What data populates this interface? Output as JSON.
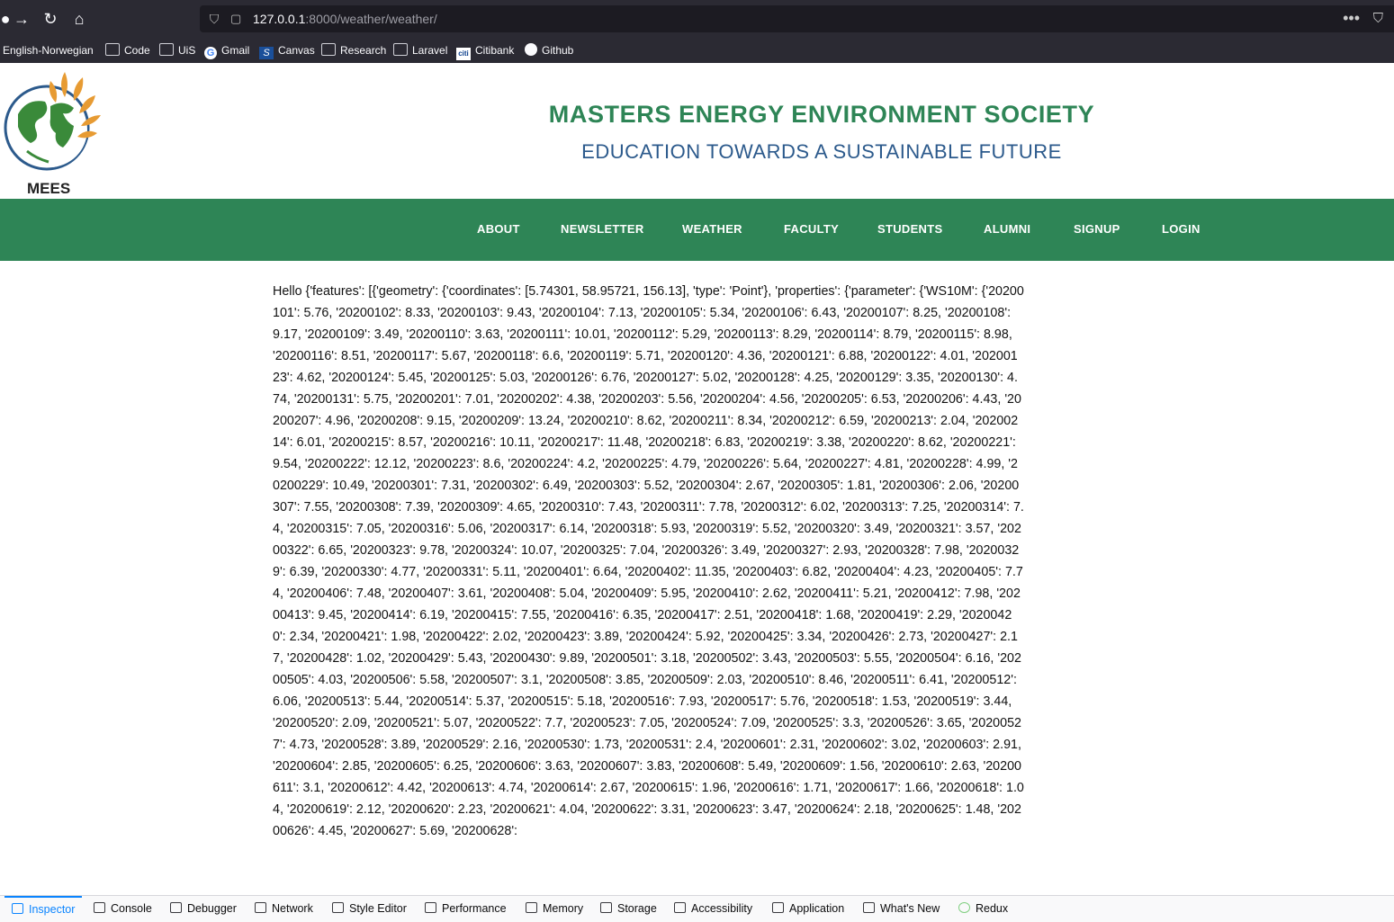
{
  "browser": {
    "url_host": "127.0.0.1",
    "url_rest": ":8000/weather/weather/",
    "bookmarks": [
      {
        "label": "English-Norwegian",
        "icon": "none"
      },
      {
        "label": "Code",
        "icon": "folder-icon"
      },
      {
        "label": "UiS",
        "icon": "folder-icon"
      },
      {
        "label": "Gmail",
        "icon": "google-icon"
      },
      {
        "label": "Canvas",
        "icon": "canvas-icon"
      },
      {
        "label": "Research",
        "icon": "folder-icon"
      },
      {
        "label": "Laravel",
        "icon": "folder-icon"
      },
      {
        "label": "Citibank",
        "icon": "citi-icon"
      },
      {
        "label": "Github",
        "icon": "github-icon"
      }
    ]
  },
  "site": {
    "logo_text": "MEES",
    "title": "MASTERS ENERGY ENVIRONMENT SOCIETY",
    "subtitle": "EDUCATION TOWARDS A SUSTAINABLE FUTURE",
    "brand_color": "#2e8556",
    "nav": [
      "ABOUT",
      "NEWSLETTER",
      "WEATHER",
      "FACULTY",
      "STUDENTS",
      "ALUMNI",
      "SIGNUP",
      "LOGIN"
    ]
  },
  "content": {
    "text": "Hello {'features': [{'geometry': {'coordinates': [5.74301, 58.95721, 156.13], 'type': 'Point'}, 'properties': {'parameter': {'WS10M': {'20200101': 5.76, '20200102': 8.33, '20200103': 9.43, '20200104': 7.13, '20200105': 5.34, '20200106': 6.43, '20200107': 8.25, '20200108': 9.17, '20200109': 3.49, '20200110': 3.63, '20200111': 10.01, '20200112': 5.29, '20200113': 8.29, '20200114': 8.79, '20200115': 8.98, '20200116': 8.51, '20200117': 5.67, '20200118': 6.6, '20200119': 5.71, '20200120': 4.36, '20200121': 6.88, '20200122': 4.01, '20200123': 4.62, '20200124': 5.45, '20200125': 5.03, '20200126': 6.76, '20200127': 5.02, '20200128': 4.25, '20200129': 3.35, '20200130': 4.74, '20200131': 5.75, '20200201': 7.01, '20200202': 4.38, '20200203': 5.56, '20200204': 4.56, '20200205': 6.53, '20200206': 4.43, '20200207': 4.96, '20200208': 9.15, '20200209': 13.24, '20200210': 8.62, '20200211': 8.34, '20200212': 6.59, '20200213': 2.04, '20200214': 6.01, '20200215': 8.57, '20200216': 10.11, '20200217': 11.48, '20200218': 6.83, '20200219': 3.38, '20200220': 8.62, '20200221': 9.54, '20200222': 12.12, '20200223': 8.6, '20200224': 4.2, '20200225': 4.79, '20200226': 5.64, '20200227': 4.81, '20200228': 4.99, '20200229': 10.49, '20200301': 7.31, '20200302': 6.49, '20200303': 5.52, '20200304': 2.67, '20200305': 1.81, '20200306': 2.06, '20200307': 7.55, '20200308': 7.39, '20200309': 4.65, '20200310': 7.43, '20200311': 7.78, '20200312': 6.02, '20200313': 7.25, '20200314': 7.4, '20200315': 7.05, '20200316': 5.06, '20200317': 6.14, '20200318': 5.93, '20200319': 5.52, '20200320': 3.49, '20200321': 3.57, '20200322': 6.65, '20200323': 9.78, '20200324': 10.07, '20200325': 7.04, '20200326': 3.49, '20200327': 2.93, '20200328': 7.98, '20200329': 6.39, '20200330': 4.77, '20200331': 5.11, '20200401': 6.64, '20200402': 11.35, '20200403': 6.82, '20200404': 4.23, '20200405': 7.74, '20200406': 7.48, '20200407': 3.61, '20200408': 5.04, '20200409': 5.95, '20200410': 2.62, '20200411': 5.21, '20200412': 7.98, '20200413': 9.45, '20200414': 6.19, '20200415': 7.55, '20200416': 6.35, '20200417': 2.51, '20200418': 1.68, '20200419': 2.29, '20200420': 2.34, '20200421': 1.98, '20200422': 2.02, '20200423': 3.89, '20200424': 5.92, '20200425': 3.34, '20200426': 2.73, '20200427': 2.17, '20200428': 1.02, '20200429': 5.43, '20200430': 9.89, '20200501': 3.18, '20200502': 3.43, '20200503': 5.55, '20200504': 6.16, '20200505': 4.03, '20200506': 5.58, '20200507': 3.1, '20200508': 3.85, '20200509': 2.03, '20200510': 8.46, '20200511': 6.41, '20200512': 6.06, '20200513': 5.44, '20200514': 5.37, '20200515': 5.18, '20200516': 7.93, '20200517': 5.76, '20200518': 1.53, '20200519': 3.44, '20200520': 2.09, '20200521': 5.07, '20200522': 7.7, '20200523': 7.05, '20200524': 7.09, '20200525': 3.3, '20200526': 3.65, '20200527': 4.73, '20200528': 3.89, '20200529': 2.16, '20200530': 1.73, '20200531': 2.4, '20200601': 2.31, '20200602': 3.02, '20200603': 2.91, '20200604': 2.85, '20200605': 6.25, '20200606': 3.63, '20200607': 3.83, '20200608': 5.49, '20200609': 1.56, '20200610': 2.63, '20200611': 3.1, '20200612': 4.42, '20200613': 4.74, '20200614': 2.67, '20200615': 1.96, '20200616': 1.71, '20200617': 1.66, '20200618': 1.04, '20200619': 2.12, '20200620': 2.23, '20200621': 4.04, '20200622': 3.31, '20200623': 3.47, '20200624': 2.18, '20200625': 1.48, '20200626': 4.45, '20200627': 5.69, '20200628':"
  },
  "devtools": {
    "tabs": [
      "Inspector",
      "Console",
      "Debugger",
      "Network",
      "Style Editor",
      "Performance",
      "Memory",
      "Storage",
      "Accessibility",
      "Application",
      "What's New",
      "Redux"
    ],
    "active_tab": "Inspector",
    "accent": "#0a84ff"
  }
}
